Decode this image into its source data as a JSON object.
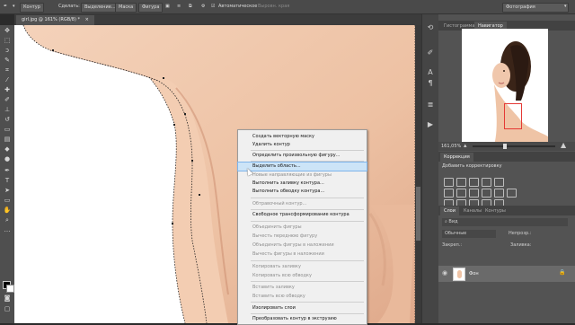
{
  "options_bar": {
    "mode": "Контур",
    "make_label": "Сделать:",
    "selection_btn": "Выделение...",
    "mask_btn": "Маска",
    "shape_btn": "Фигура",
    "autoadd_label": "Автоматическое",
    "align_edges": "Выровн. края",
    "workspace": "Фотография"
  },
  "document": {
    "tab_title": "girl.jpg @ 161% (RGB/8) *"
  },
  "navigator": {
    "tab_histogram": "Гистограмма",
    "tab_navigator": "Навигатор",
    "zoom": "161,05%"
  },
  "adjustments": {
    "tab": "Коррекция",
    "add_label": "Добавить корректировку"
  },
  "layers": {
    "tab_layers": "Слои",
    "tab_channels": "Каналы",
    "tab_paths": "Контуры",
    "filter": "Вид",
    "blend_mode": "Обычные",
    "opacity_label": "Непрозр.:",
    "fill_label": "Заливка:",
    "lock_label": "Закреп.:",
    "layer_name": "Фон"
  },
  "context_menu": {
    "items": [
      {
        "label": "Создать векторную маску",
        "disabled": false,
        "highlighted": false
      },
      {
        "label": "Удалить контур",
        "disabled": false,
        "highlighted": false
      },
      {
        "label": "Определить произвольную фигуру...",
        "disabled": false,
        "highlighted": false
      },
      {
        "label": "Выделить область...",
        "disabled": false,
        "highlighted": true
      },
      {
        "label": "Новые направляющие из фигуры",
        "disabled": true,
        "highlighted": false
      },
      {
        "label": "Выполнить заливку контура...",
        "disabled": false,
        "highlighted": false
      },
      {
        "label": "Выполнить обводку контура...",
        "disabled": false,
        "highlighted": false
      },
      {
        "label": "Обтравочный контур...",
        "disabled": true,
        "highlighted": false
      },
      {
        "label": "Свободное трансформирование контура",
        "disabled": false,
        "highlighted": false
      },
      {
        "label": "Объединить фигуры",
        "disabled": true,
        "highlighted": false
      },
      {
        "label": "Вычесть переднюю фигуру",
        "disabled": true,
        "highlighted": false
      },
      {
        "label": "Объединить фигуры в наложении",
        "disabled": true,
        "highlighted": false
      },
      {
        "label": "Вычесть фигуры в наложении",
        "disabled": true,
        "highlighted": false
      },
      {
        "label": "Копировать заливку",
        "disabled": true,
        "highlighted": false
      },
      {
        "label": "Копировать всю обводку",
        "disabled": true,
        "highlighted": false
      },
      {
        "label": "Вставить заливку",
        "disabled": true,
        "highlighted": false
      },
      {
        "label": "Вставить всю обводку",
        "disabled": true,
        "highlighted": false
      },
      {
        "label": "Изолировать слои",
        "disabled": false,
        "highlighted": false
      },
      {
        "label": "Преобразовать контур в экструзию",
        "disabled": false,
        "highlighted": false
      }
    ]
  },
  "colors": {
    "highlight": "#cce4f7",
    "menu_bg": "#f0f0f0",
    "red_box": "#e53935",
    "skin": "#f2c9ae"
  }
}
